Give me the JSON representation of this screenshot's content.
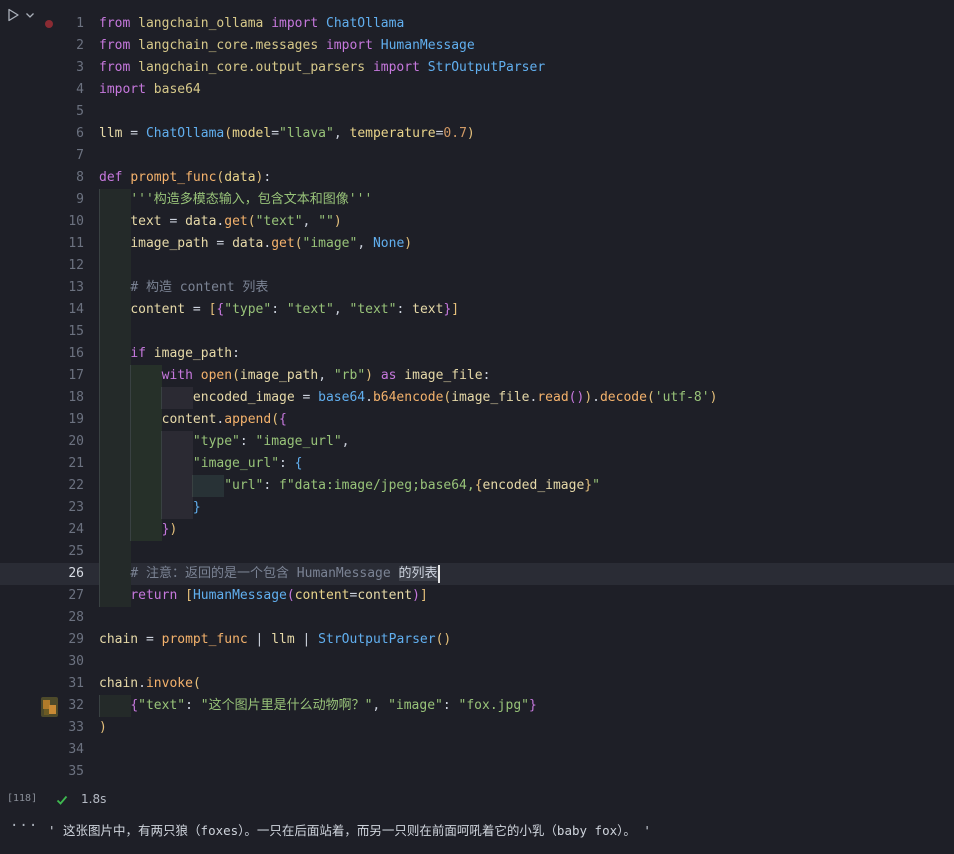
{
  "cell": {
    "execution_count": "[118]",
    "exec_time": "1.8s",
    "active_line": 26
  },
  "icons": {
    "run": "play-icon",
    "run_dropdown": "chevron-down-icon",
    "breakpoint": "breakpoint-dot",
    "status": "check-icon",
    "thumb": "image-preview-icon",
    "more": "more-icon"
  },
  "colors": {
    "background": "#1e1f27",
    "keyword": "#c678dd",
    "string": "#98c379",
    "class": "#61afef",
    "function": "#f4b26c",
    "success": "#3fb950",
    "breakpoint": "#8a2b33"
  },
  "code_lines": [
    {
      "n": "1",
      "tokens": [
        [
          "kw",
          "from"
        ],
        [
          "op",
          " "
        ],
        [
          "mod",
          "langchain_ollama"
        ],
        [
          "op",
          " "
        ],
        [
          "kw",
          "import"
        ],
        [
          "op",
          " "
        ],
        [
          "cls",
          "ChatOllama"
        ]
      ]
    },
    {
      "n": "2",
      "tokens": [
        [
          "kw",
          "from"
        ],
        [
          "op",
          " "
        ],
        [
          "mod",
          "langchain_core.messages"
        ],
        [
          "op",
          " "
        ],
        [
          "kw",
          "import"
        ],
        [
          "op",
          " "
        ],
        [
          "cls",
          "HumanMessage"
        ]
      ]
    },
    {
      "n": "3",
      "tokens": [
        [
          "kw",
          "from"
        ],
        [
          "op",
          " "
        ],
        [
          "mod",
          "langchain_core.output_parsers"
        ],
        [
          "op",
          " "
        ],
        [
          "kw",
          "import"
        ],
        [
          "op",
          " "
        ],
        [
          "cls",
          "StrOutputParser"
        ]
      ]
    },
    {
      "n": "4",
      "tokens": [
        [
          "kw",
          "import"
        ],
        [
          "op",
          " "
        ],
        [
          "mod",
          "base64"
        ]
      ]
    },
    {
      "n": "5",
      "tokens": []
    },
    {
      "n": "6",
      "tokens": [
        [
          "var",
          "llm"
        ],
        [
          "op",
          " = "
        ],
        [
          "cls",
          "ChatOllama"
        ],
        [
          "brace",
          "("
        ],
        [
          "param",
          "model"
        ],
        [
          "op",
          "="
        ],
        [
          "str",
          "\"llava\""
        ],
        [
          "op",
          ", "
        ],
        [
          "param",
          "temperature"
        ],
        [
          "op",
          "="
        ],
        [
          "num",
          "0.7"
        ],
        [
          "brace",
          ")"
        ]
      ]
    },
    {
      "n": "7",
      "tokens": []
    },
    {
      "n": "8",
      "tokens": [
        [
          "kw",
          "def"
        ],
        [
          "op",
          " "
        ],
        [
          "fn",
          "prompt_func"
        ],
        [
          "brace",
          "("
        ],
        [
          "param",
          "data"
        ],
        [
          "brace",
          ")"
        ],
        [
          "op",
          ":"
        ]
      ]
    },
    {
      "n": "9",
      "tokens": [
        [
          "op",
          "    "
        ],
        [
          "str",
          "'''构造多模态输入，包含文本和图像'''"
        ]
      ]
    },
    {
      "n": "10",
      "tokens": [
        [
          "op",
          "    "
        ],
        [
          "var",
          "text"
        ],
        [
          "op",
          " = "
        ],
        [
          "var",
          "data"
        ],
        [
          "op",
          "."
        ],
        [
          "fn",
          "get"
        ],
        [
          "brace",
          "("
        ],
        [
          "str",
          "\"text\""
        ],
        [
          "op",
          ", "
        ],
        [
          "str",
          "\"\""
        ],
        [
          "brace",
          ")"
        ]
      ]
    },
    {
      "n": "11",
      "tokens": [
        [
          "op",
          "    "
        ],
        [
          "var",
          "image_path"
        ],
        [
          "op",
          " = "
        ],
        [
          "var",
          "data"
        ],
        [
          "op",
          "."
        ],
        [
          "fn",
          "get"
        ],
        [
          "brace",
          "("
        ],
        [
          "str",
          "\"image\""
        ],
        [
          "op",
          ", "
        ],
        [
          "cls",
          "None"
        ],
        [
          "brace",
          ")"
        ]
      ]
    },
    {
      "n": "12",
      "tokens": []
    },
    {
      "n": "13",
      "tokens": [
        [
          "op",
          "    "
        ],
        [
          "cm",
          "# 构造 content 列表"
        ]
      ]
    },
    {
      "n": "14",
      "tokens": [
        [
          "op",
          "    "
        ],
        [
          "var",
          "content"
        ],
        [
          "op",
          " = "
        ],
        [
          "brace",
          "["
        ],
        [
          "brace2",
          "{"
        ],
        [
          "str",
          "\"type\""
        ],
        [
          "op",
          ": "
        ],
        [
          "str",
          "\"text\""
        ],
        [
          "op",
          ", "
        ],
        [
          "str",
          "\"text\""
        ],
        [
          "op",
          ": "
        ],
        [
          "var",
          "text"
        ],
        [
          "brace2",
          "}"
        ],
        [
          "brace",
          "]"
        ]
      ]
    },
    {
      "n": "15",
      "tokens": []
    },
    {
      "n": "16",
      "tokens": [
        [
          "op",
          "    "
        ],
        [
          "kw",
          "if"
        ],
        [
          "op",
          " "
        ],
        [
          "var",
          "image_path"
        ],
        [
          "op",
          ":"
        ]
      ]
    },
    {
      "n": "17",
      "tokens": [
        [
          "op",
          "        "
        ],
        [
          "kw",
          "with"
        ],
        [
          "op",
          " "
        ],
        [
          "fn",
          "open"
        ],
        [
          "brace",
          "("
        ],
        [
          "var",
          "image_path"
        ],
        [
          "op",
          ", "
        ],
        [
          "str",
          "\"rb\""
        ],
        [
          "brace",
          ")"
        ],
        [
          "op",
          " "
        ],
        [
          "kw",
          "as"
        ],
        [
          "op",
          " "
        ],
        [
          "var",
          "image_file"
        ],
        [
          "op",
          ":"
        ]
      ]
    },
    {
      "n": "18",
      "tokens": [
        [
          "op",
          "            "
        ],
        [
          "var",
          "encoded_image"
        ],
        [
          "op",
          " = "
        ],
        [
          "cls",
          "base64"
        ],
        [
          "op",
          "."
        ],
        [
          "fn",
          "b64encode"
        ],
        [
          "brace",
          "("
        ],
        [
          "var",
          "image_file"
        ],
        [
          "op",
          "."
        ],
        [
          "fn",
          "read"
        ],
        [
          "brace2",
          "()"
        ],
        [
          "brace",
          ")"
        ],
        [
          "op",
          "."
        ],
        [
          "fn",
          "decode"
        ],
        [
          "brace",
          "("
        ],
        [
          "str",
          "'utf-8'"
        ],
        [
          "brace",
          ")"
        ]
      ]
    },
    {
      "n": "19",
      "tokens": [
        [
          "op",
          "        "
        ],
        [
          "var",
          "content"
        ],
        [
          "op",
          "."
        ],
        [
          "fn",
          "append"
        ],
        [
          "brace",
          "("
        ],
        [
          "brace2",
          "{"
        ]
      ]
    },
    {
      "n": "20",
      "tokens": [
        [
          "op",
          "            "
        ],
        [
          "str",
          "\"type\""
        ],
        [
          "op",
          ": "
        ],
        [
          "str",
          "\"image_url\""
        ],
        [
          "op",
          ","
        ]
      ]
    },
    {
      "n": "21",
      "tokens": [
        [
          "op",
          "            "
        ],
        [
          "str",
          "\"image_url\""
        ],
        [
          "op",
          ": "
        ],
        [
          "brace3",
          "{"
        ]
      ]
    },
    {
      "n": "22",
      "tokens": [
        [
          "op",
          "                "
        ],
        [
          "str",
          "\"url\""
        ],
        [
          "op",
          ": "
        ],
        [
          "str",
          "f\"data:image/jpeg;base64,"
        ],
        [
          "brace",
          "{"
        ],
        [
          "var",
          "encoded_image"
        ],
        [
          "brace",
          "}"
        ],
        [
          "str",
          "\""
        ]
      ]
    },
    {
      "n": "23",
      "tokens": [
        [
          "op",
          "            "
        ],
        [
          "brace3",
          "}"
        ]
      ]
    },
    {
      "n": "24",
      "tokens": [
        [
          "op",
          "        "
        ],
        [
          "brace2",
          "}"
        ],
        [
          "brace",
          ")"
        ]
      ]
    },
    {
      "n": "25",
      "tokens": []
    },
    {
      "n": "26",
      "tokens": [
        [
          "op",
          "    "
        ],
        [
          "cm",
          "# 注意：返回的是一个包含 HumanMessage "
        ],
        [
          "sel",
          "的列表"
        ]
      ]
    },
    {
      "n": "27",
      "tokens": [
        [
          "op",
          "    "
        ],
        [
          "kw",
          "return"
        ],
        [
          "op",
          " "
        ],
        [
          "brace",
          "["
        ],
        [
          "cls",
          "HumanMessage"
        ],
        [
          "brace2",
          "("
        ],
        [
          "param",
          "content"
        ],
        [
          "op",
          "="
        ],
        [
          "var",
          "content"
        ],
        [
          "brace2",
          ")"
        ],
        [
          "brace",
          "]"
        ]
      ]
    },
    {
      "n": "28",
      "tokens": []
    },
    {
      "n": "29",
      "tokens": [
        [
          "var",
          "chain"
        ],
        [
          "op",
          " = "
        ],
        [
          "fn",
          "prompt_func"
        ],
        [
          "op",
          " | "
        ],
        [
          "var",
          "llm"
        ],
        [
          "op",
          " | "
        ],
        [
          "cls",
          "StrOutputParser"
        ],
        [
          "brace",
          "()"
        ]
      ]
    },
    {
      "n": "30",
      "tokens": []
    },
    {
      "n": "31",
      "tokens": [
        [
          "var",
          "chain"
        ],
        [
          "op",
          "."
        ],
        [
          "fn",
          "invoke"
        ],
        [
          "brace",
          "("
        ]
      ]
    },
    {
      "n": "32",
      "tokens": [
        [
          "op",
          "    "
        ],
        [
          "brace2",
          "{"
        ],
        [
          "str",
          "\"text\""
        ],
        [
          "op",
          ": "
        ],
        [
          "str",
          "\"这个图片里是什么动物啊？\""
        ],
        [
          "op",
          ", "
        ],
        [
          "str",
          "\"image\""
        ],
        [
          "op",
          ": "
        ],
        [
          "str",
          "\"fox.jpg\""
        ],
        [
          "brace2",
          "}"
        ]
      ]
    },
    {
      "n": "33",
      "tokens": [
        [
          "brace",
          ")"
        ]
      ]
    },
    {
      "n": "34",
      "tokens": []
    },
    {
      "n": "35",
      "tokens": []
    }
  ],
  "output": {
    "text": "' 这张图片中，有两只狼（foxes）。一只在后面站着，而另一只则在前面呵吼着它的小乳（baby fox）。 '"
  }
}
